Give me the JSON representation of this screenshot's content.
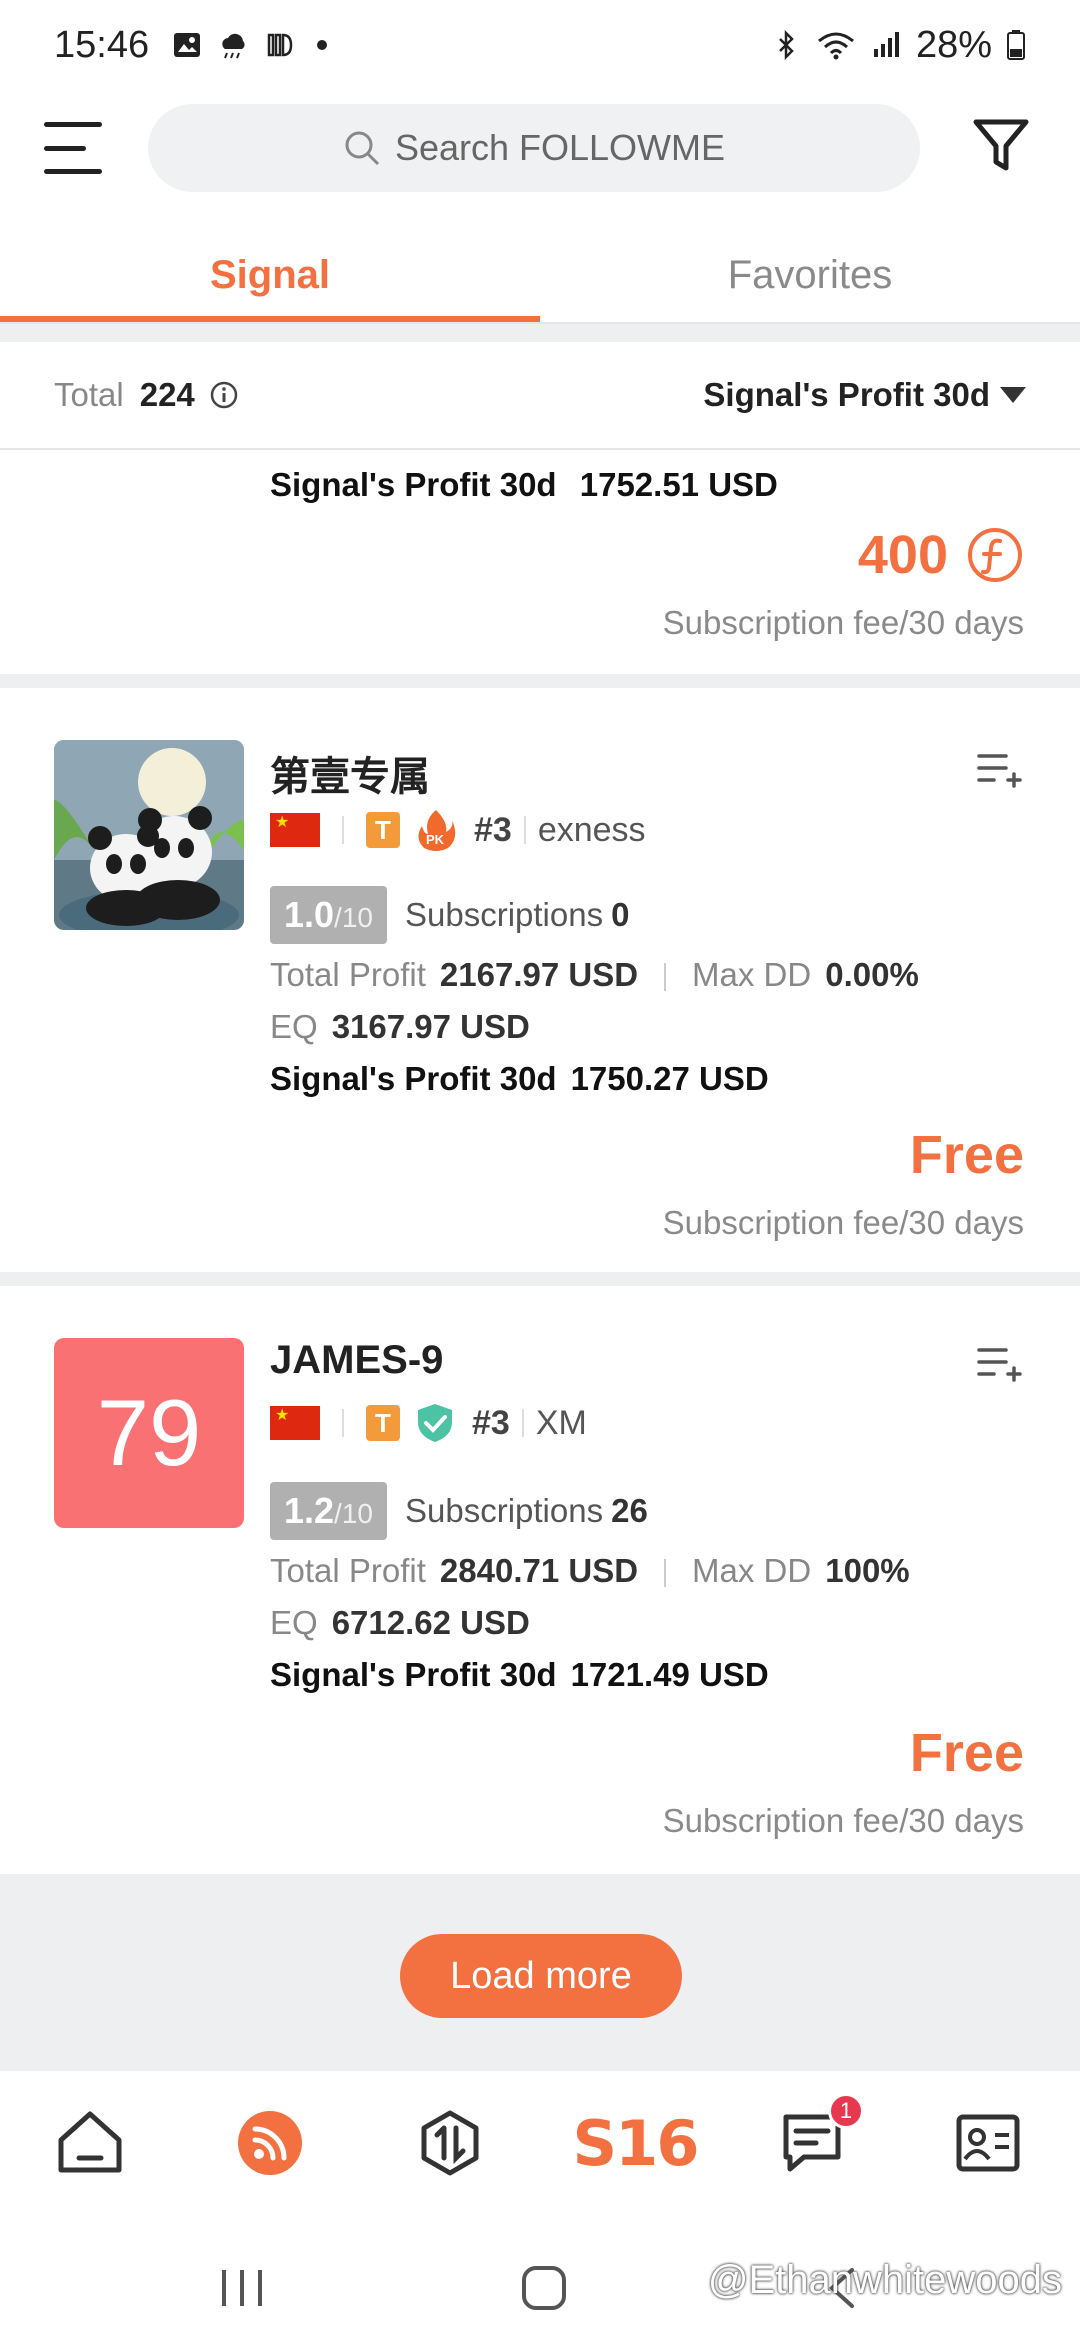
{
  "status_bar": {
    "time": "15:46",
    "battery": "28%"
  },
  "header": {
    "search_placeholder": "Search FOLLOWME"
  },
  "tabs": [
    {
      "label": "Signal",
      "active": true
    },
    {
      "label": "Favorites",
      "active": false
    }
  ],
  "summary": {
    "total_label": "Total",
    "total_value": "224",
    "sort_label": "Signal's Profit 30d"
  },
  "partial_card": {
    "profit30_label": "Signal's Profit 30d",
    "profit30_value": "1752.51 USD",
    "fee_amount": "400",
    "fee_label": "Subscription fee/30 days"
  },
  "cards": [
    {
      "name": "第壹专属",
      "trader_badge": "T",
      "rank": "#3",
      "broker": "exness",
      "score": "1.0",
      "score_max": "/10",
      "subs_label": "Subscriptions",
      "subs_value": "0",
      "total_profit_label": "Total Profit",
      "total_profit_value": "2167.97 USD",
      "maxdd_label": "Max DD",
      "maxdd_value": "0.00%",
      "eq_label": "EQ",
      "eq_value": "3167.97 USD",
      "profit30_label": "Signal's Profit 30d",
      "profit30_value": "1750.27 USD",
      "fee_amount": "Free",
      "fee_label": "Subscription fee/30 days"
    },
    {
      "name": "JAMES-9",
      "avatar_score": "79",
      "trader_badge": "T",
      "rank": "#3",
      "broker": "XM",
      "score": "1.2",
      "score_max": "/10",
      "subs_label": "Subscriptions",
      "subs_value": "26",
      "total_profit_label": "Total Profit",
      "total_profit_value": "2840.71 USD",
      "maxdd_label": "Max DD",
      "maxdd_value": "100%",
      "eq_label": "EQ",
      "eq_value": "6712.62 USD",
      "profit30_label": "Signal's Profit 30d",
      "profit30_value": "1721.49 USD",
      "fee_amount": "Free",
      "fee_label": "Subscription fee/30 days"
    }
  ],
  "load_more": "Load more",
  "bottom_nav": {
    "center_label": "S16",
    "messages_badge": "1"
  },
  "watermark": "@Ethanwhitewoods",
  "colors": {
    "accent": "#f37041",
    "score_avatar_bg": "#f97172",
    "badge_red": "#e8384f"
  }
}
